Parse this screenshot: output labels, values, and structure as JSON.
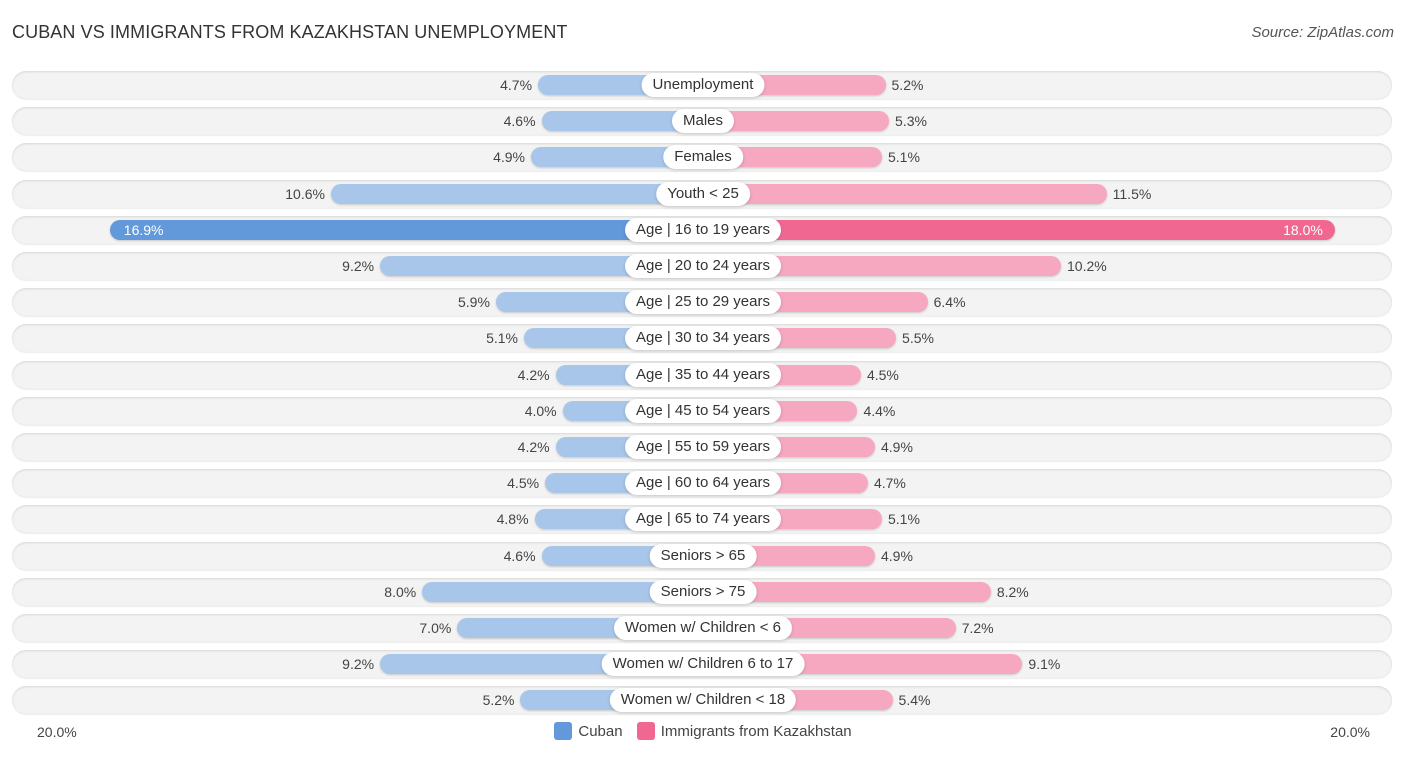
{
  "header": {
    "title": "CUBAN VS IMMIGRANTS FROM KAZAKHSTAN UNEMPLOYMENT",
    "source": "Source: ZipAtlas.com"
  },
  "colors": {
    "cuban": "#a7c6ea",
    "cuban_highlight": "#6199da",
    "kazakhstan": "#f5a8c0",
    "kazakhstan_highlight": "#f06892"
  },
  "chart_data": {
    "type": "bar",
    "orientation": "horizontal-diverging",
    "title": "CUBAN VS IMMIGRANTS FROM KAZAKHSTAN UNEMPLOYMENT",
    "categories": [
      "Unemployment",
      "Males",
      "Females",
      "Youth < 25",
      "Age | 16 to 19 years",
      "Age | 20 to 24 years",
      "Age | 25 to 29 years",
      "Age | 30 to 34 years",
      "Age | 35 to 44 years",
      "Age | 45 to 54 years",
      "Age | 55 to 59 years",
      "Age | 60 to 64 years",
      "Age | 65 to 74 years",
      "Seniors > 65",
      "Seniors > 75",
      "Women w/ Children < 6",
      "Women w/ Children 6 to 17",
      "Women w/ Children < 18"
    ],
    "series": [
      {
        "name": "Cuban",
        "side": "left",
        "values": [
          4.7,
          4.6,
          4.9,
          10.6,
          16.9,
          9.2,
          5.9,
          5.1,
          4.2,
          4.0,
          4.2,
          4.5,
          4.8,
          4.6,
          8.0,
          7.0,
          9.2,
          5.2
        ],
        "labels": [
          "4.7%",
          "4.6%",
          "4.9%",
          "10.6%",
          "16.9%",
          "9.2%",
          "5.9%",
          "5.1%",
          "4.2%",
          "4.0%",
          "4.2%",
          "4.5%",
          "4.8%",
          "4.6%",
          "8.0%",
          "7.0%",
          "9.2%",
          "5.2%"
        ]
      },
      {
        "name": "Immigrants from Kazakhstan",
        "side": "right",
        "values": [
          5.2,
          5.3,
          5.1,
          11.5,
          18.0,
          10.2,
          6.4,
          5.5,
          4.5,
          4.4,
          4.9,
          4.7,
          5.1,
          4.9,
          8.2,
          7.2,
          9.1,
          5.4
        ],
        "labels": [
          "5.2%",
          "5.3%",
          "5.1%",
          "11.5%",
          "18.0%",
          "10.2%",
          "6.4%",
          "5.5%",
          "4.5%",
          "4.4%",
          "4.9%",
          "4.7%",
          "5.1%",
          "4.9%",
          "8.2%",
          "7.2%",
          "9.1%",
          "5.4%"
        ]
      }
    ],
    "highlight_index": 4,
    "xlim": [
      0,
      20.0
    ],
    "axis_labels": {
      "left": "20.0%",
      "right": "20.0%"
    },
    "legend": [
      "Cuban",
      "Immigrants from Kazakhstan"
    ],
    "legend_position": "bottom-center",
    "grid": false
  }
}
